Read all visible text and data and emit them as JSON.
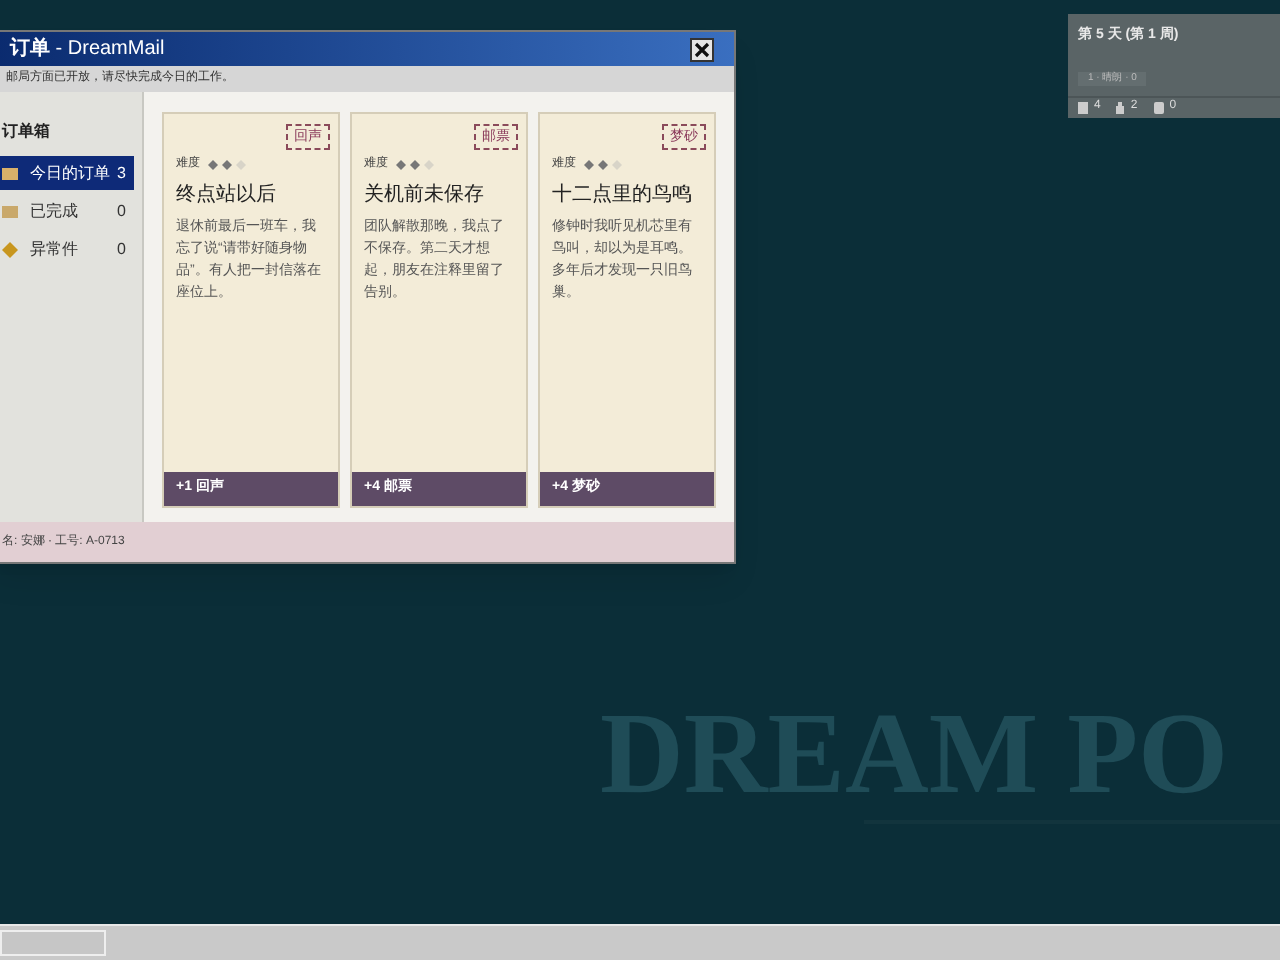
{
  "window": {
    "title": "订单",
    "app": " - DreamMail",
    "notice": "邮局方面已开放，请尽快完成今日的工作。"
  },
  "sidebar": {
    "heading": "订单箱",
    "items": [
      {
        "label": "今日的订单",
        "count": "3",
        "selected": true,
        "kind": "inbox"
      },
      {
        "label": "已完成",
        "count": "0",
        "selected": false,
        "kind": "done"
      },
      {
        "label": "异常件",
        "count": "0",
        "selected": false,
        "kind": "warning"
      }
    ]
  },
  "cards": [
    {
      "stamp": "回声",
      "difficulty_label": "难度",
      "stars": 2,
      "title": "终点站以后",
      "body": "退休前最后一班车，我忘了说“请带好随身物品”。有人把一封信落在座位上。",
      "reward": "+1 回声"
    },
    {
      "stamp": "邮票",
      "difficulty_label": "难度",
      "stars": 2,
      "title": "关机前未保存",
      "body": "团队解散那晚，我点了不保存。第二天才想起，朋友在注释里留了告别。",
      "reward": "+4 邮票"
    },
    {
      "stamp": "梦砂",
      "difficulty_label": "难度",
      "stars": 2,
      "title": "十二点里的鸟鸣",
      "body": "修钟时我听见机芯里有鸟叫，却以为是耳鸣。多年后才发现一只旧鸟巢。",
      "reward": "+4 梦砂"
    }
  ],
  "status_bar": "名: 安娜 · 工号: A-0713",
  "day_widget": {
    "title": "第 5 天 (第 1 周)",
    "weather": "1 · 晴朗 · 0",
    "stats": [
      "4",
      "2",
      "0"
    ]
  },
  "wallpaper": {
    "logo": "DREAM PO"
  }
}
